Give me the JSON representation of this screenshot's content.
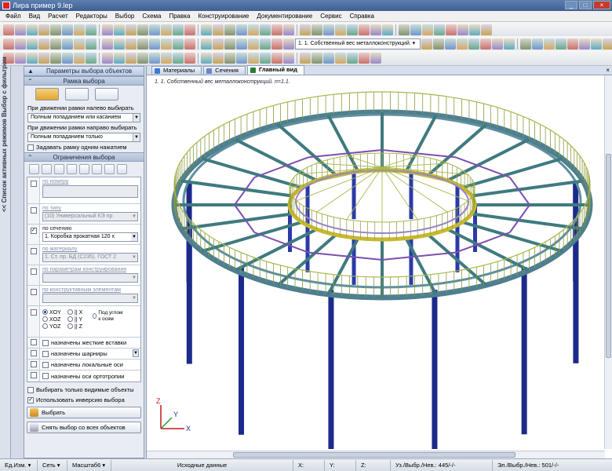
{
  "window": {
    "title": "Лира пример 9.lep"
  },
  "menu": [
    "Файл",
    "Вид",
    "Расчет",
    "Редакторы",
    "Выбор",
    "Схема",
    "Правка",
    "Конструирование",
    "Документирование",
    "Сервис",
    "Справка"
  ],
  "toolbar": {
    "load_case": "1. 1. Собственный вес металлоконструкций. ▾"
  },
  "sidebar_tab": {
    "label": "<< Список активных режимов   Выбор с фильтром"
  },
  "panel": {
    "title": "Параметры выбора объектов",
    "frame_section": "Рамка выбора",
    "left_label": "При движении рамки налево выбирать",
    "left_mode": "Полным попаданием или касанием",
    "right_label": "При движении рамки направо выбирать",
    "right_mode": "Полным попаданием только",
    "single_click_label": "Задавать рамку одним нажатием",
    "limits_section": "Ограничения выбора",
    "filters": {
      "by_number": "по номеру",
      "by_type": "по типу",
      "type_value": "(10) Универсальный КЭ пр",
      "by_section": "по сечению",
      "section_value": "1. Коробка прокатная 120 х",
      "by_material": "по материалу",
      "material_value": "1. Ст. пр. БД (С235). ГОСТ 2",
      "by_design_params": "по параметрам конструирования",
      "by_structural": "по конструктивным элементам"
    },
    "axes": {
      "xoy": "XOY",
      "x": "|| X",
      "xoz": "XOZ",
      "y": "|| Y",
      "yoz": "YOZ",
      "z": "|| Z",
      "angle": "Под углом к осям"
    },
    "options": {
      "rigid": "назначены жесткие вставки",
      "hinges": "назначены шарниры",
      "local_axes": "назначены локальные оси",
      "ortho_axes": "назначены оси ортотропии"
    },
    "only_visible": "Выбирать только видимые объекты",
    "use_inverse": "Использовать инверсию выбора",
    "select_button": "Выбрать",
    "clear_button": "Снять выбор со всех объектов"
  },
  "tabs": [
    "Материалы",
    "Сечения",
    "Главный вид"
  ],
  "view": {
    "title": "1. 1. Собственный вес металлоконструкций. n=1.1."
  },
  "axes_gizmo": {
    "x": "X",
    "y": "Y",
    "z": "Z"
  },
  "status": {
    "units": "Ед.Изм.",
    "grid": "Сеть",
    "scale": "Масштаб6",
    "source": "Исходные данные",
    "x": "X:",
    "y": "Y:",
    "z": "Z:",
    "nodes": "Уз./Выбр./Нев.: 445/-/-",
    "elements": "Эл./Выбр./Нев.: 501/-/-"
  }
}
